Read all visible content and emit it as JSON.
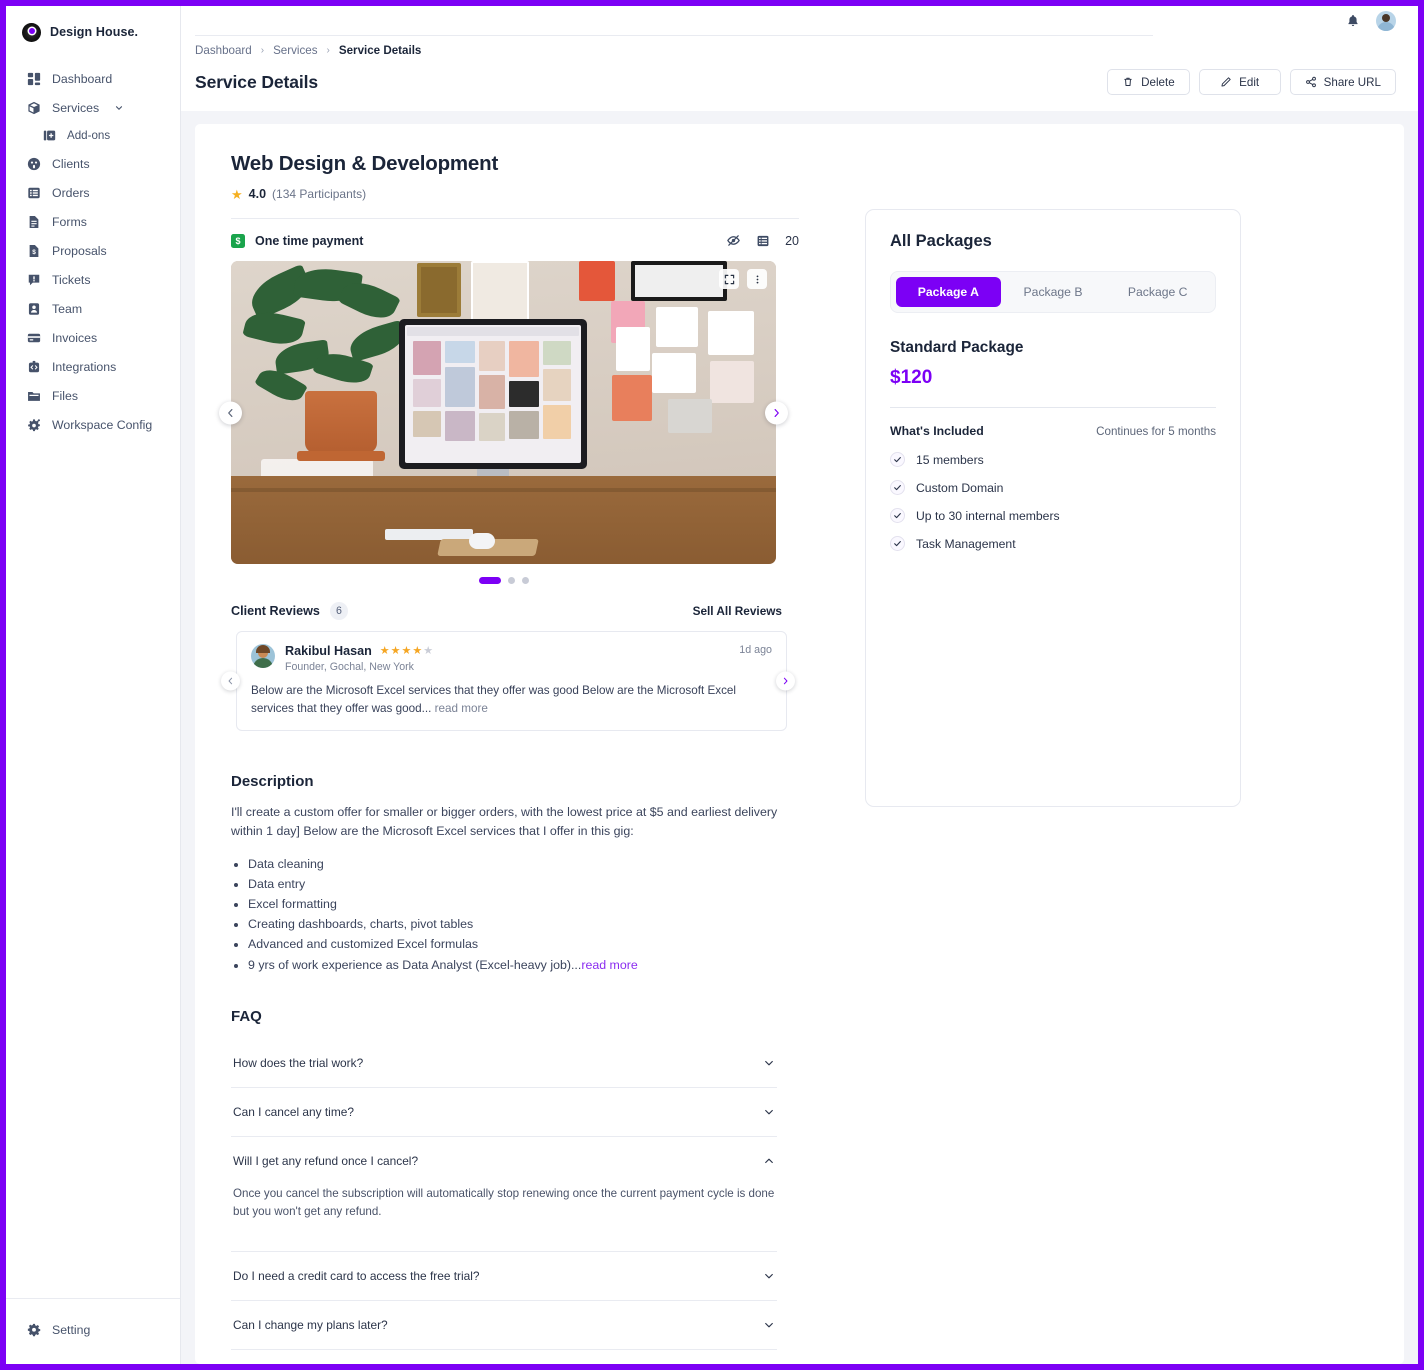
{
  "brand": {
    "name": "Design House."
  },
  "sidebar": {
    "items": [
      {
        "label": "Dashboard",
        "icon": "dashboard-icon"
      },
      {
        "label": "Services",
        "icon": "package-icon",
        "expandable": true
      },
      {
        "label": "Add-ons",
        "icon": "add-ons-icon",
        "sub": true
      },
      {
        "label": "Clients",
        "icon": "clients-icon"
      },
      {
        "label": "Orders",
        "icon": "orders-icon"
      },
      {
        "label": "Forms",
        "icon": "forms-icon"
      },
      {
        "label": "Proposals",
        "icon": "proposals-icon"
      },
      {
        "label": "Tickets",
        "icon": "tickets-icon"
      },
      {
        "label": "Team",
        "icon": "team-icon"
      },
      {
        "label": "Invoices",
        "icon": "invoices-icon"
      },
      {
        "label": "Integrations",
        "icon": "integrations-icon"
      },
      {
        "label": "Files",
        "icon": "files-icon"
      },
      {
        "label": "Workspace Config",
        "icon": "workspace-config-icon"
      }
    ],
    "footer": {
      "label": "Setting",
      "icon": "gear-icon"
    }
  },
  "topbar": {
    "bell": "bell-icon",
    "avatar": "user-avatar"
  },
  "breadcrumb": [
    {
      "label": "Dashboard"
    },
    {
      "label": "Services"
    },
    {
      "label": "Service Details"
    }
  ],
  "header": {
    "title": "Service Details",
    "actions": [
      {
        "label": "Delete",
        "icon": "trash-icon"
      },
      {
        "label": "Edit",
        "icon": "pencil-icon"
      },
      {
        "label": "Share URL",
        "icon": "share-icon"
      }
    ]
  },
  "service": {
    "title": "Web Design & Development",
    "rating_value": "4.0",
    "rating_count": "(134 Participants)",
    "payment_label": "One time payment",
    "payment_badge": "$",
    "visibility_icon": "eye-off-icon",
    "list_icon": "list-icon",
    "list_count": "20",
    "carousel": {
      "fullscreen_icon": "fullscreen-icon",
      "menu_icon": "more-vertical-icon",
      "prev_icon": "chevron-left-icon",
      "next_icon": "chevron-right-icon",
      "slides": 3,
      "active_slide": 1
    }
  },
  "reviews": {
    "title": "Client Reviews",
    "count": "6",
    "see_all": "Sell All Reviews",
    "items": [
      {
        "name": "Rakibul Hasan",
        "stars": 4,
        "max_stars": 5,
        "role": "Founder, Gochal, New York",
        "time": "1d ago",
        "text": "Below are the Microsoft Excel services that they offer was good Below are the Microsoft Excel services that they offer was good...",
        "read_more": " read more"
      }
    ]
  },
  "description": {
    "heading": "Description",
    "paragraph": "I'll create a custom offer for smaller or bigger orders, with the lowest price at $5 and earliest delivery within 1 day] Below are the Microsoft Excel services that I offer in this gig:",
    "bullets": [
      "Data cleaning",
      "Data entry",
      "Excel formatting",
      "Creating dashboards, charts, pivot tables",
      "Advanced and customized Excel formulas",
      "9 yrs of work experience as Data Analyst (Excel-heavy job)..."
    ],
    "read_more": "read more"
  },
  "faq": {
    "heading": "FAQ",
    "items": [
      {
        "question": "How does the trial work?",
        "open": false,
        "answer": ""
      },
      {
        "question": "Can I cancel any time?",
        "open": false,
        "answer": ""
      },
      {
        "question": "Will I get any refund once I cancel?",
        "open": true,
        "answer": "Once you cancel the subscription will automatically stop renewing once the current payment cycle is done but you won't get any refund."
      },
      {
        "question": "Do I need a credit card to access the free trial?",
        "open": false,
        "answer": ""
      },
      {
        "question": "Can I change my plans later?",
        "open": false,
        "answer": ""
      }
    ]
  },
  "packages": {
    "title": "All Packages",
    "tabs": [
      {
        "label": "Package A",
        "active": true
      },
      {
        "label": "Package B",
        "active": false
      },
      {
        "label": "Package C",
        "active": false
      }
    ],
    "selected": {
      "name": "Standard Package",
      "price": "$120",
      "included_label": "What's Included",
      "duration": "Continues for 5 months",
      "features": [
        "15 members",
        "Custom Domain",
        "Up to 30 internal members",
        "Task Management"
      ]
    }
  },
  "colors": {
    "accent": "#7c00f5",
    "page_bg": "#f3f4f8",
    "text_dark": "#1b2539",
    "star": "#f5a623",
    "green": "#1aa44c"
  }
}
